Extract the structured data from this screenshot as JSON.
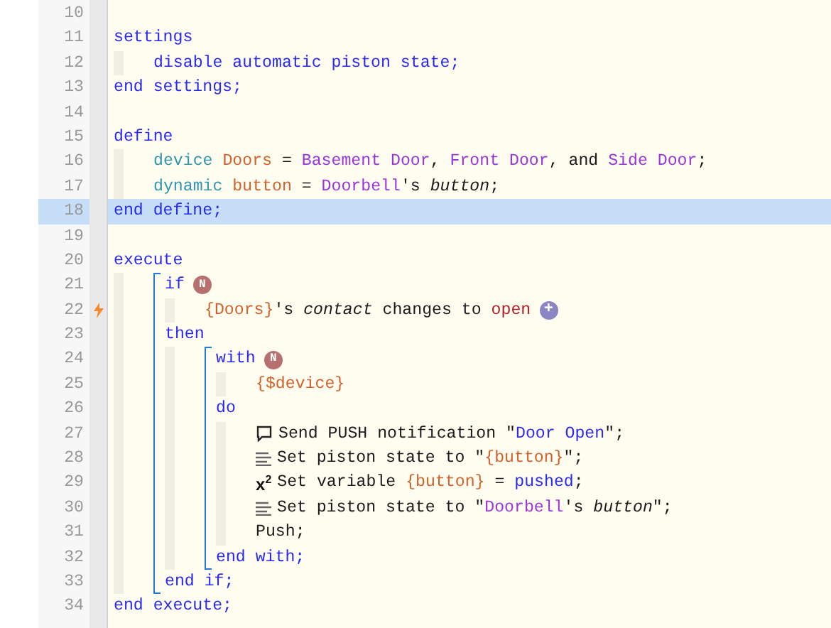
{
  "editor": {
    "code": [
      {
        "kind": "line",
        "number": "10",
        "selected": false,
        "trigger": false
      },
      {
        "kind": "line",
        "number": "11",
        "selected": false,
        "trigger": false,
        "tokens": [
          {
            "kind": "keyword",
            "s": "settings"
          }
        ]
      },
      {
        "kind": "indent",
        "children": [
          {
            "kind": "line",
            "number": "12",
            "selected": false,
            "trigger": false,
            "tokens": [
              {
                "kind": "keyword",
                "s": "disable automatic piston state;"
              }
            ]
          }
        ]
      },
      {
        "kind": "line",
        "number": "13",
        "selected": false,
        "trigger": false,
        "tokens": [
          {
            "kind": "keyword",
            "s": "end settings;"
          }
        ]
      },
      {
        "kind": "line",
        "number": "14",
        "selected": false,
        "trigger": false
      },
      {
        "kind": "line",
        "number": "15",
        "selected": false,
        "trigger": false,
        "tokens": [
          {
            "kind": "keyword",
            "s": "define"
          }
        ]
      },
      {
        "kind": "indent",
        "children": [
          {
            "kind": "line",
            "number": "16",
            "selected": false,
            "trigger": false,
            "tokens": [
              {
                "kind": "type",
                "s": "device "
              },
              {
                "kind": "name",
                "s": "Doors"
              },
              {
                "kind": "text",
                "s": " = "
              },
              {
                "kind": "device",
                "s": "Basement Door"
              },
              {
                "kind": "text",
                "s": ", "
              },
              {
                "kind": "device",
                "s": "Front Door"
              },
              {
                "kind": "text",
                "s": ", and "
              },
              {
                "kind": "device",
                "s": "Side Door"
              },
              {
                "kind": "text",
                "s": ";"
              }
            ]
          },
          {
            "kind": "line",
            "number": "17",
            "selected": false,
            "trigger": false,
            "tokens": [
              {
                "kind": "type",
                "s": "dynamic "
              },
              {
                "kind": "name",
                "s": "button"
              },
              {
                "kind": "text",
                "s": " = "
              },
              {
                "kind": "device",
                "s": "Doorbell"
              },
              {
                "kind": "text",
                "s": "'s "
              },
              {
                "kind": "italic",
                "s": "button"
              },
              {
                "kind": "text",
                "s": ";"
              }
            ]
          }
        ]
      },
      {
        "kind": "line",
        "number": "18",
        "selected": true,
        "trigger": false,
        "tokens": [
          {
            "kind": "keyword",
            "s": "end define;"
          }
        ]
      },
      {
        "kind": "line",
        "number": "19",
        "selected": false,
        "trigger": false
      },
      {
        "kind": "line",
        "number": "20",
        "selected": false,
        "trigger": false,
        "tokens": [
          {
            "kind": "keyword",
            "s": "execute"
          }
        ]
      },
      {
        "kind": "indent",
        "children": [
          {
            "kind": "bracket",
            "children": [
              {
                "kind": "line",
                "number": "21",
                "selected": false,
                "trigger": false,
                "tokens": [
                  {
                    "kind": "keyword",
                    "s": "if"
                  },
                  {
                    "kind": "badge",
                    "s": "N"
                  }
                ]
              },
              {
                "kind": "indent",
                "children": [
                  {
                    "kind": "line",
                    "number": "22",
                    "selected": false,
                    "trigger": true,
                    "tokens": [
                      {
                        "kind": "name",
                        "s": "{Doors}"
                      },
                      {
                        "kind": "text",
                        "s": "'s "
                      },
                      {
                        "kind": "italic",
                        "s": "contact"
                      },
                      {
                        "kind": "text",
                        "s": " changes to "
                      },
                      {
                        "kind": "value",
                        "s": "open"
                      },
                      {
                        "kind": "add",
                        "s": "+"
                      }
                    ]
                  }
                ]
              },
              {
                "kind": "line",
                "number": "23",
                "selected": false,
                "trigger": false,
                "tokens": [
                  {
                    "kind": "keyword",
                    "s": "then"
                  }
                ]
              },
              {
                "kind": "indent",
                "children": [
                  {
                    "kind": "bracket",
                    "children": [
                      {
                        "kind": "line",
                        "number": "24",
                        "selected": false,
                        "trigger": false,
                        "tokens": [
                          {
                            "kind": "keyword",
                            "s": "with"
                          },
                          {
                            "kind": "badge",
                            "s": "N"
                          }
                        ]
                      },
                      {
                        "kind": "indent",
                        "children": [
                          {
                            "kind": "line",
                            "number": "25",
                            "selected": false,
                            "trigger": false,
                            "tokens": [
                              {
                                "kind": "name",
                                "s": "{$device}"
                              }
                            ]
                          }
                        ]
                      },
                      {
                        "kind": "line",
                        "number": "26",
                        "selected": false,
                        "trigger": false,
                        "tokens": [
                          {
                            "kind": "keyword",
                            "s": "do"
                          }
                        ]
                      },
                      {
                        "kind": "indent",
                        "children": [
                          {
                            "kind": "line",
                            "number": "27",
                            "selected": false,
                            "trigger": false,
                            "tokens": [
                              {
                                "kind": "notify-icon"
                              },
                              {
                                "kind": "text",
                                "s": "Send PUSH notification \""
                              },
                              {
                                "kind": "string",
                                "s": "Door Open"
                              },
                              {
                                "kind": "text",
                                "s": "\";"
                              }
                            ]
                          },
                          {
                            "kind": "line",
                            "number": "28",
                            "selected": false,
                            "trigger": false,
                            "tokens": [
                              {
                                "kind": "state-icon"
                              },
                              {
                                "kind": "text",
                                "s": "Set piston state to \""
                              },
                              {
                                "kind": "name",
                                "s": "{button}"
                              },
                              {
                                "kind": "text",
                                "s": "\";"
                              }
                            ]
                          },
                          {
                            "kind": "line",
                            "number": "29",
                            "selected": false,
                            "trigger": false,
                            "tokens": [
                              {
                                "kind": "symbol",
                                "s": "x$^{2}$"
                              },
                              {
                                "kind": "text",
                                "s": "Set variable "
                              },
                              {
                                "kind": "name",
                                "s": "{button}"
                              },
                              {
                                "kind": "text",
                                "s": " = "
                              },
                              {
                                "kind": "string",
                                "s": "pushed"
                              },
                              {
                                "kind": "text",
                                "s": ";"
                              }
                            ]
                          },
                          {
                            "kind": "line",
                            "number": "30",
                            "selected": false,
                            "trigger": false,
                            "tokens": [
                              {
                                "kind": "state-icon"
                              },
                              {
                                "kind": "text",
                                "s": "Set piston state to \""
                              },
                              {
                                "kind": "device",
                                "s": "Doorbell"
                              },
                              {
                                "kind": "text",
                                "s": "'s "
                              },
                              {
                                "kind": "italic",
                                "s": "button"
                              },
                              {
                                "kind": "text",
                                "s": "\";"
                              }
                            ]
                          },
                          {
                            "kind": "line",
                            "number": "31",
                            "selected": false,
                            "trigger": false,
                            "tokens": [
                              {
                                "kind": "text",
                                "s": "Push;"
                              }
                            ]
                          }
                        ]
                      },
                      {
                        "kind": "line",
                        "number": "32",
                        "selected": false,
                        "trigger": false,
                        "tokens": [
                          {
                            "kind": "keyword",
                            "s": "end with;"
                          }
                        ]
                      }
                    ]
                  }
                ]
              },
              {
                "kind": "line",
                "number": "33",
                "selected": false,
                "trigger": false,
                "tokens": [
                  {
                    "kind": "keyword",
                    "s": "end if;"
                  }
                ]
              }
            ]
          }
        ]
      },
      {
        "kind": "line",
        "number": "34",
        "selected": false,
        "trigger": false,
        "tokens": [
          {
            "kind": "keyword",
            "s": "end execute;"
          }
        ]
      }
    ]
  }
}
